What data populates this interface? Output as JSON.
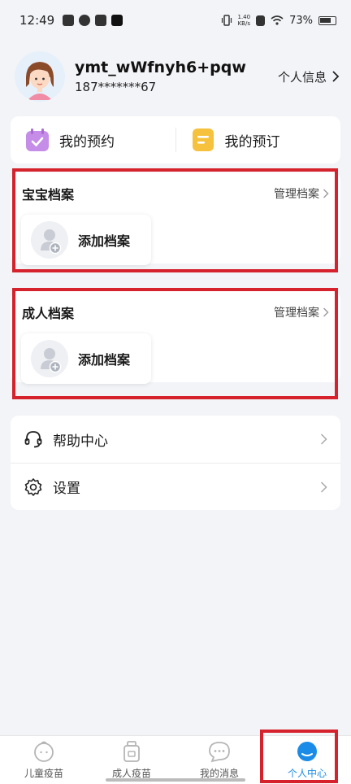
{
  "status_bar": {
    "time": "12:49",
    "net_speed_value": "1.40",
    "net_speed_unit": "KB/s",
    "battery": "73%"
  },
  "profile": {
    "username": "ymt_wWfnyh6+pqw",
    "phone": "187*******67",
    "info_link": "个人信息"
  },
  "quick_actions": [
    {
      "label": "我的预约",
      "icon": "calendar-check-icon",
      "color": "#c58ce8"
    },
    {
      "label": "我的预订",
      "icon": "document-icon",
      "color": "#f6c13c"
    }
  ],
  "baby_section": {
    "title": "宝宝档案",
    "manage": "管理档案",
    "add_label": "添加档案"
  },
  "adult_section": {
    "title": "成人档案",
    "manage": "管理档案",
    "add_label": "添加档案"
  },
  "menu": [
    {
      "label": "帮助中心",
      "icon": "headset-icon"
    },
    {
      "label": "设置",
      "icon": "gear-icon"
    }
  ],
  "tabs": [
    {
      "label": "儿童疫苗",
      "icon": "child-icon",
      "active": false
    },
    {
      "label": "成人疫苗",
      "icon": "bottle-icon",
      "active": false
    },
    {
      "label": "我的消息",
      "icon": "message-icon",
      "active": false
    },
    {
      "label": "个人中心",
      "icon": "profile-icon",
      "active": true
    }
  ],
  "colors": {
    "accent": "#1a8ce8",
    "highlight_frame": "#d5222c"
  }
}
